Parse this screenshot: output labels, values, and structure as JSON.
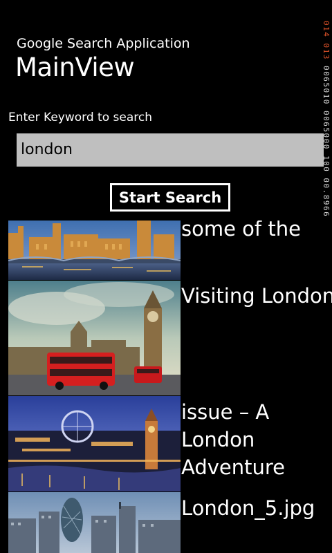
{
  "header": {
    "app_title": "Google Search Application",
    "page_title": "MainView"
  },
  "search": {
    "label": "Enter Keyword to search",
    "value": "london",
    "button_label": "Start Search"
  },
  "results": [
    {
      "caption": "some of the",
      "image": "houses-of-parliament-dusk-image"
    },
    {
      "caption": "Visiting London",
      "image": "big-ben-red-bus-image"
    },
    {
      "caption": "issue – A London Adventure",
      "image": "london-eye-night-skyline-image"
    },
    {
      "caption": "London_5.jpg",
      "image": "city-skyline-gherkin-image"
    }
  ],
  "debug_counter": {
    "text_highlight": "014 013",
    "text": "0065010 0065000 100 00.8966"
  },
  "colors": {
    "background": "#000000",
    "text": "#ffffff",
    "search_box": "#bfbfbf",
    "counter_accent": "#e0532a"
  }
}
